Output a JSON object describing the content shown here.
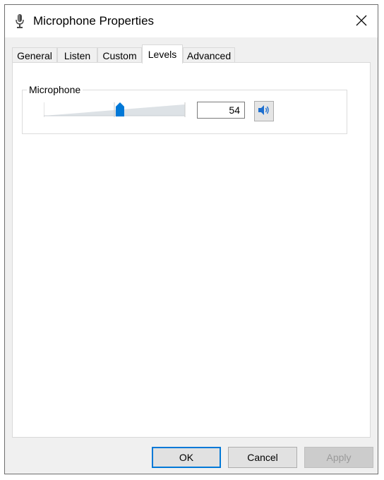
{
  "window": {
    "title": "Microphone Properties"
  },
  "tabs": [
    {
      "label": "General"
    },
    {
      "label": "Listen"
    },
    {
      "label": "Custom"
    },
    {
      "label": "Levels",
      "active": true
    },
    {
      "label": "Advanced"
    }
  ],
  "levels": {
    "group_label": "Microphone",
    "level_value": "54",
    "slider_value": 54,
    "slider_range": [
      0,
      100
    ]
  },
  "buttons": {
    "ok": "OK",
    "cancel": "Cancel",
    "apply": "Apply"
  },
  "colors": {
    "accent": "#0078d7",
    "slider_track": "#dde2e6",
    "window_bg": "#f0f0f0"
  }
}
